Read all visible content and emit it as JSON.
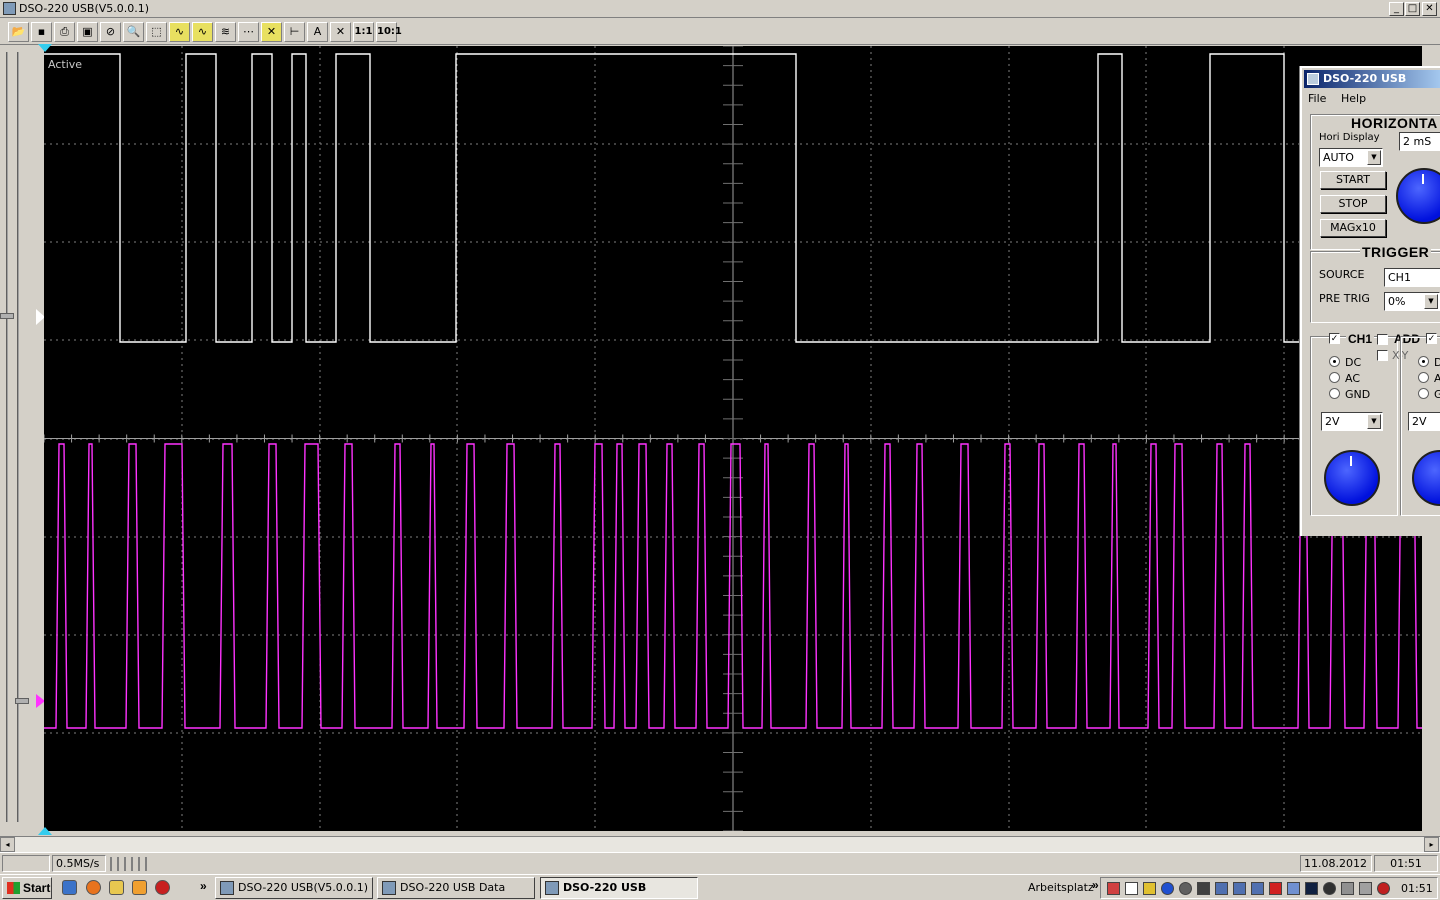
{
  "window": {
    "title": "DSO-220 USB(V5.0.0.1)",
    "min_label": "_",
    "max_label": "□",
    "close_label": "✕"
  },
  "toolbar": {
    "ratio_1_label": "1:1",
    "ratio_10_label": "10:1"
  },
  "scope": {
    "status_label": "Active",
    "ch1_color": "#ffffff",
    "ch2_color": "#ff33ff",
    "grid_color": "#808080"
  },
  "statusbar": {
    "sample_rate": "0.5MS/s",
    "date": "11.08.2012",
    "time": "01:51"
  },
  "taskbar": {
    "start_label": "Start",
    "overflow_label": "»",
    "tasks": [
      {
        "label": "DSO-220 USB(V5.0.0.1)"
      },
      {
        "label": "DSO-220 USB Data"
      },
      {
        "label": "DSO-220 USB"
      }
    ],
    "tray_label": "Arbeitsplatz",
    "clock": "01:51"
  },
  "panel": {
    "title": "DSO-220 USB",
    "menu": {
      "file": "File",
      "help": "Help"
    },
    "horizontal": {
      "title": "HORIZONTA",
      "hori_display_label": "Hori Display",
      "hori_display_value": "AUTO",
      "timebase_value": "2 mS",
      "start_label": "START",
      "stop_label": "STOP",
      "mag_label": "MAGx10"
    },
    "trigger": {
      "title": "TRIGGER",
      "source_label": "SOURCE",
      "source_value": "CH1",
      "pretrig_label": "PRE TRIG",
      "pretrig_value": "0%"
    },
    "ch1": {
      "label": "CH1",
      "add_label": "ADD",
      "xy_label": "X-Y",
      "dc_label": "DC",
      "ac_label": "AC",
      "gnd_label": "GND",
      "volts_value": "2V"
    },
    "ch2": {
      "dc_label": "D",
      "ac_label": "A",
      "gnd_label": "G",
      "volts_value": "2V"
    }
  }
}
